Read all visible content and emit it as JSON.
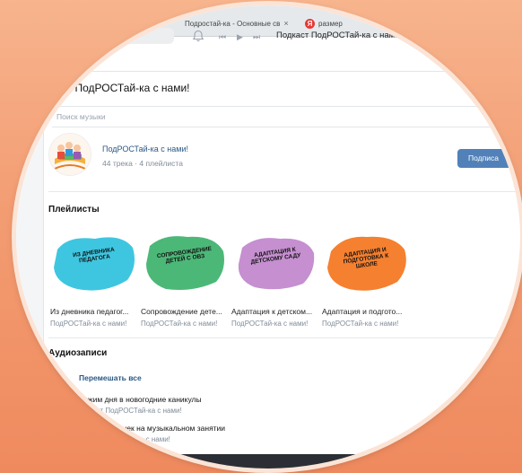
{
  "browser": {
    "tab1_title": "Подростай-ка - Основные св",
    "tab1_close": "×",
    "tab2_title": "размер"
  },
  "player": {
    "prev_icon": "⏮",
    "play_icon": "▶",
    "next_icon": "⏭",
    "now_playing": "Подкаст ПодРОСТай-ка с нами! — Ад..."
  },
  "page": {
    "title": "...ка ПодРОСТай-ка с нами!",
    "search_placeholder": "Поиск музыки"
  },
  "owner": {
    "name": "ПодРОСТай-ка с нами!",
    "stats": "44 трека · 4 плейлиста",
    "subscribe_label": "Подписа"
  },
  "playlists_section": {
    "title": "Плейлисты",
    "items": [
      {
        "cover_text": "Из дневника педагога",
        "title": "Из дневника педагог...",
        "author": "ПодРОСТай-ка с нами!",
        "color": "#3ec6e0"
      },
      {
        "cover_text": "Сопровождение детей с ОВЗ",
        "title": "Сопровождение дете...",
        "author": "ПодРОСТай-ка с нами!",
        "color": "#4cb878"
      },
      {
        "cover_text": "Адаптация к детскому саду",
        "title": "Адаптация к детском...",
        "author": "ПодРОСТай-ка с нами!",
        "color": "#c58fd0"
      },
      {
        "cover_text": "Адаптация и подготовка к школе",
        "title": "Адаптация и подгото...",
        "author": "ПодРОСТай-ка с нами!",
        "color": "#f5802f"
      }
    ]
  },
  "audio_section": {
    "title": "Аудиозаписи",
    "shuffle_label": "Перемешать все",
    "tracks": [
      {
        "title": "Режим дня в новогодние каникулы",
        "artist": "...дкаст ПодРОСТай-ка с нами!"
      },
      {
        "title": "...имость чешек на музыкальном занятии",
        "artist": "...ст ПодРОСТай-ка с нами!"
      }
    ]
  },
  "colors": {
    "accent": "#5181b8",
    "link": "#2a5885",
    "muted": "#818c99",
    "background_frame": "#f39c72"
  }
}
